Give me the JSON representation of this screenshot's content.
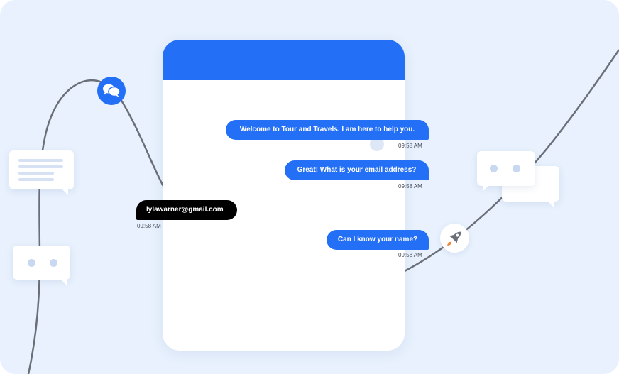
{
  "messages": [
    {
      "from": "bot",
      "text": "Welcome to Tour and Travels. I am here to help you.",
      "time": "09:58 AM"
    },
    {
      "from": "bot",
      "text": "Great! What is your email address?",
      "time": "09:58 AM"
    },
    {
      "from": "user",
      "text": "lylawarner@gmail.com",
      "time": "09:58 AM"
    },
    {
      "from": "bot",
      "text": "Can I know your name?",
      "time": "09:58 AM"
    }
  ],
  "colors": {
    "background": "#e8f1fd",
    "accent": "#236ff5",
    "user_bubble": "#000000",
    "rocket_accent": "#f0883a"
  },
  "icons": {
    "chat": "chat-bubbles-icon",
    "rocket": "rocket-icon"
  }
}
